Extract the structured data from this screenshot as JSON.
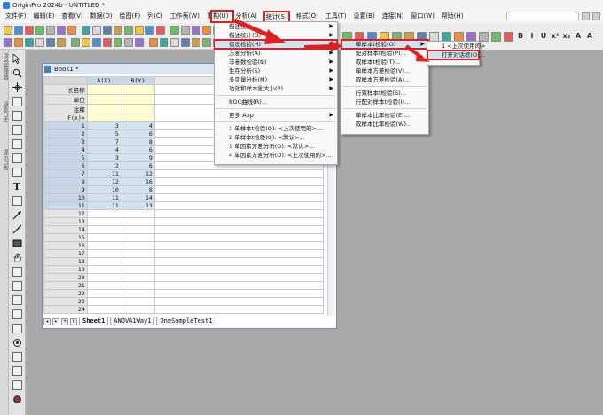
{
  "window": {
    "title": "OriginPro 2024b - UNTITLED *"
  },
  "menubar": {
    "items": [
      "文件(F)",
      "编辑(E)",
      "查看(V)",
      "数据(D)",
      "绘图(P)",
      "列(C)",
      "工作表(W)",
      "重构(U)",
      "分析(A)",
      "统计(S)",
      "格式(O)",
      "工具(T)",
      "设置(B)",
      "连接(N)",
      "窗口(W)",
      "帮助(H)"
    ],
    "active_index": 9
  },
  "toolbar": {
    "right_text": [
      "B",
      "I",
      "U",
      "x²",
      "x₂",
      "A",
      "A"
    ]
  },
  "sidebar": {
    "tabs": [
      "项目管理器",
      "消息日志",
      "提示日志"
    ]
  },
  "tools": {
    "text_tool": "T"
  },
  "book": {
    "title": "Book1 *",
    "columns": [
      "A(X)",
      "B(Y)"
    ],
    "meta_rows": [
      "长名称",
      "单位",
      "注释",
      "F(x)="
    ],
    "rows": [
      {
        "n": "1",
        "a": "3",
        "b": "4"
      },
      {
        "n": "2",
        "a": "5",
        "b": "6"
      },
      {
        "n": "3",
        "a": "7",
        "b": "8"
      },
      {
        "n": "4",
        "a": "4",
        "b": "6"
      },
      {
        "n": "5",
        "a": "3",
        "b": "9"
      },
      {
        "n": "6",
        "a": "2",
        "b": "6"
      },
      {
        "n": "7",
        "a": "11",
        "b": "12"
      },
      {
        "n": "8",
        "a": "12",
        "b": "16"
      },
      {
        "n": "9",
        "a": "10",
        "b": "8"
      },
      {
        "n": "10",
        "a": "11",
        "b": "14"
      },
      {
        "n": "11",
        "a": "11",
        "b": "13"
      }
    ],
    "empty_rows": [
      "12",
      "13",
      "14",
      "15",
      "16",
      "17",
      "18",
      "19",
      "20",
      "21",
      "22",
      "23",
      "24"
    ],
    "sheet_tabs": [
      "Sheet1",
      "ANOVA1Way1",
      "OneSampleTest1"
    ],
    "sheet_nav": [
      "◂",
      "▸",
      "+",
      "∨"
    ]
  },
  "stats_menu": {
    "items": [
      {
        "label": "描述统计",
        "arrow": true
      },
      {
        "label": "描述统计(D)",
        "arrow": true
      },
      {
        "label": "假设检验(H)",
        "arrow": true,
        "highlight": true
      },
      {
        "label": "方差分析(A)",
        "arrow": true
      },
      {
        "label": "非参数检验(N)",
        "arrow": true
      },
      {
        "label": "生存分析(S)",
        "arrow": true
      },
      {
        "label": "多变量分析(M)",
        "arrow": true
      },
      {
        "label": "功效和样本量大小(P)",
        "arrow": true
      },
      {
        "sep": true
      },
      {
        "label": "ROC曲线(R)...",
        "arrow": false
      },
      {
        "sep": true
      },
      {
        "label": "更多 App",
        "arrow": true
      },
      {
        "sep": true
      },
      {
        "label": "1 单样本t检验(O): <上次使用的>...",
        "arrow": false
      },
      {
        "label": "2 单样本t检验(O): <默认>...",
        "arrow": false
      },
      {
        "label": "3 单因素方差分析(O): <默认>...",
        "arrow": false
      },
      {
        "label": "4 单因素方差分析(O): <上次使用的>...",
        "arrow": false
      }
    ]
  },
  "hyp_menu": {
    "items": [
      {
        "label": "单样本t检验(O)",
        "arrow": true,
        "highlight": true
      },
      {
        "label": "配对样本t检验(P)...",
        "arrow": false
      },
      {
        "label": "双样本t检验(T)...",
        "arrow": false
      },
      {
        "label": "单样本方差检验(V)...",
        "arrow": false
      },
      {
        "label": "双样本方差检验(A)...",
        "arrow": false
      },
      {
        "sep": true
      },
      {
        "label": "行双样本t检验(S)...",
        "arrow": false
      },
      {
        "label": "行配对样本t检验(I)...",
        "arrow": false
      },
      {
        "sep": true
      },
      {
        "label": "单样本比率检验(E)...",
        "arrow": false
      },
      {
        "label": "双样本比率检验(W)...",
        "arrow": false
      }
    ]
  },
  "ttest_menu": {
    "items": [
      {
        "label": "1 <上次使用的>",
        "highlight": false
      },
      {
        "label": "打开对话框(O)...",
        "highlight": true
      }
    ]
  },
  "colors": {
    "annotation_red": "#e02020",
    "selection_blue": "#d3e2f1",
    "meta_yellow": "#fffbd3"
  }
}
